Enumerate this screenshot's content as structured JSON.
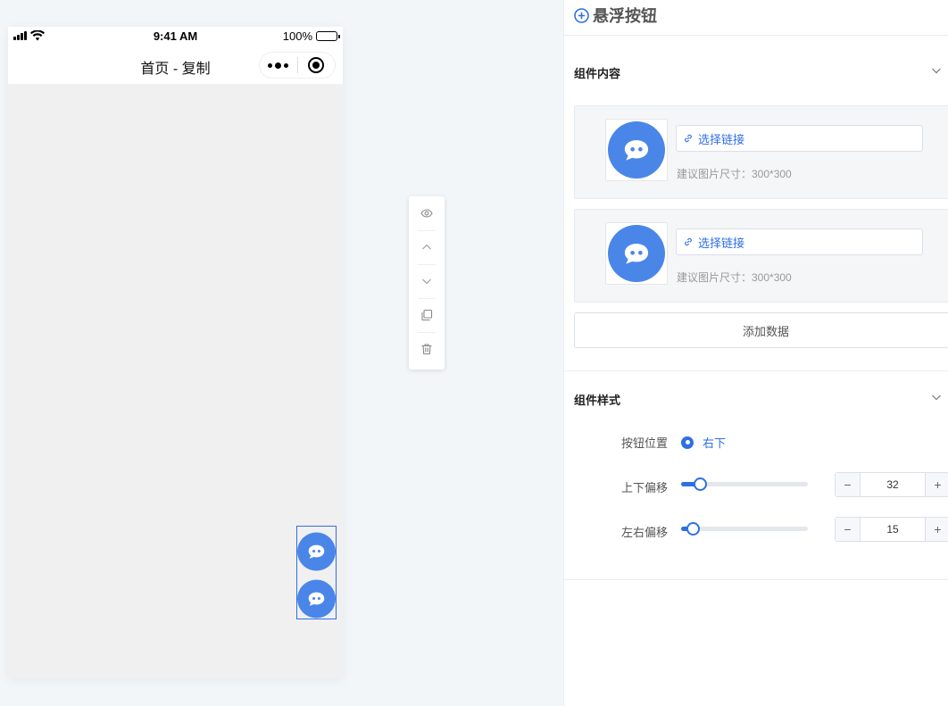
{
  "phone": {
    "time": "9:41 AM",
    "battery": "100%",
    "nav_title": "首页 - 复制"
  },
  "toolbar": {
    "icons": [
      "eye-icon",
      "chevron-up-icon",
      "chevron-down-icon",
      "copy-icon",
      "trash-icon"
    ]
  },
  "panel": {
    "title": "悬浮按钮",
    "content_section": {
      "title": "组件内容",
      "items": [
        {
          "link_label": "选择链接",
          "hint": "建议图片尺寸：300*300"
        },
        {
          "link_label": "选择链接",
          "hint": "建议图片尺寸：300*300"
        }
      ],
      "add_label": "添加数据"
    },
    "style_section": {
      "title": "组件样式",
      "position_label": "按钮位置",
      "position_value": "右下",
      "vertical_label": "上下偏移",
      "vertical_value": "32",
      "horizontal_label": "左右偏移",
      "horizontal_value": "15",
      "minus": "−",
      "plus": "+"
    }
  },
  "colors": {
    "accent": "#2f6fe4",
    "chat_bubble": "#4a86e8"
  }
}
